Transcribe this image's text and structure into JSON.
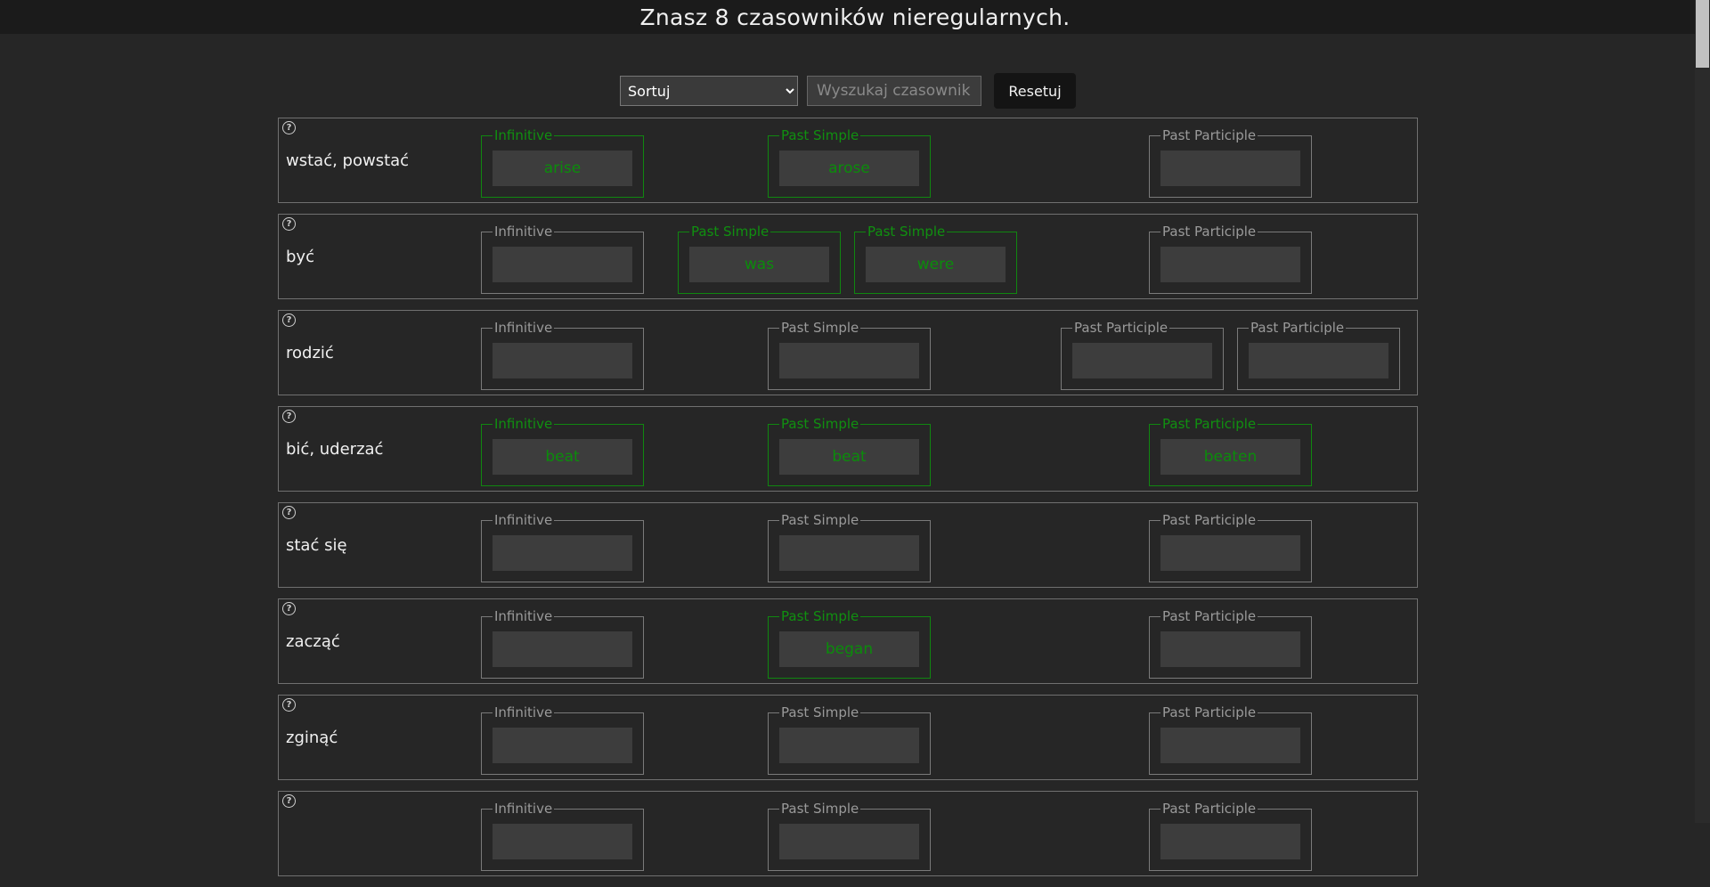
{
  "header": {
    "title": "Znasz 8 czasowników nieregularnych."
  },
  "controls": {
    "sort_value": "Sortuj",
    "search_placeholder": "Wyszukaj czasownik",
    "reset_label": "Resetuj"
  },
  "labels": {
    "infinitive": "Infinitive",
    "past_simple": "Past Simple",
    "past_participle": "Past Participle"
  },
  "help_symbol": "?",
  "colors": {
    "correct": "#108710",
    "background": "#262626",
    "topbar": "#1b1b1b"
  },
  "verbs": [
    {
      "meaning": "wstać, powstać",
      "fields": [
        {
          "label": "Infinitive",
          "value": "arise",
          "correct": true
        },
        {
          "label": "Past Simple",
          "value": "arose",
          "correct": true
        },
        {
          "label": "Past Participle",
          "value": "",
          "correct": false
        }
      ]
    },
    {
      "meaning": "być",
      "fields": [
        {
          "label": "Infinitive",
          "value": "",
          "correct": false
        },
        {
          "label": "Past Simple",
          "value": "was",
          "correct": true
        },
        {
          "label": "Past Simple",
          "value": "were",
          "correct": true
        },
        {
          "label": "Past Participle",
          "value": "",
          "correct": false
        }
      ]
    },
    {
      "meaning": "rodzić",
      "fields": [
        {
          "label": "Infinitive",
          "value": "",
          "correct": false
        },
        {
          "label": "Past Simple",
          "value": "",
          "correct": false
        },
        {
          "label": "Past Participle",
          "value": "",
          "correct": false
        },
        {
          "label": "Past Participle",
          "value": "",
          "correct": false
        }
      ]
    },
    {
      "meaning": "bić, uderzać",
      "fields": [
        {
          "label": "Infinitive",
          "value": "beat",
          "correct": true
        },
        {
          "label": "Past Simple",
          "value": "beat",
          "correct": true
        },
        {
          "label": "Past Participle",
          "value": "beaten",
          "correct": true
        }
      ]
    },
    {
      "meaning": "stać się",
      "fields": [
        {
          "label": "Infinitive",
          "value": "",
          "correct": false
        },
        {
          "label": "Past Simple",
          "value": "",
          "correct": false
        },
        {
          "label": "Past Participle",
          "value": "",
          "correct": false
        }
      ]
    },
    {
      "meaning": "zacząć",
      "fields": [
        {
          "label": "Infinitive",
          "value": "",
          "correct": false
        },
        {
          "label": "Past Simple",
          "value": "began",
          "correct": true
        },
        {
          "label": "Past Participle",
          "value": "",
          "correct": false
        }
      ]
    },
    {
      "meaning": "zginąć",
      "fields": [
        {
          "label": "Infinitive",
          "value": "",
          "correct": false
        },
        {
          "label": "Past Simple",
          "value": "",
          "correct": false
        },
        {
          "label": "Past Participle",
          "value": "",
          "correct": false
        }
      ]
    },
    {
      "meaning": "",
      "fields": [
        {
          "label": "Infinitive",
          "value": "",
          "correct": false
        },
        {
          "label": "Past Simple",
          "value": "",
          "correct": false
        },
        {
          "label": "Past Participle",
          "value": "",
          "correct": false
        }
      ]
    }
  ]
}
